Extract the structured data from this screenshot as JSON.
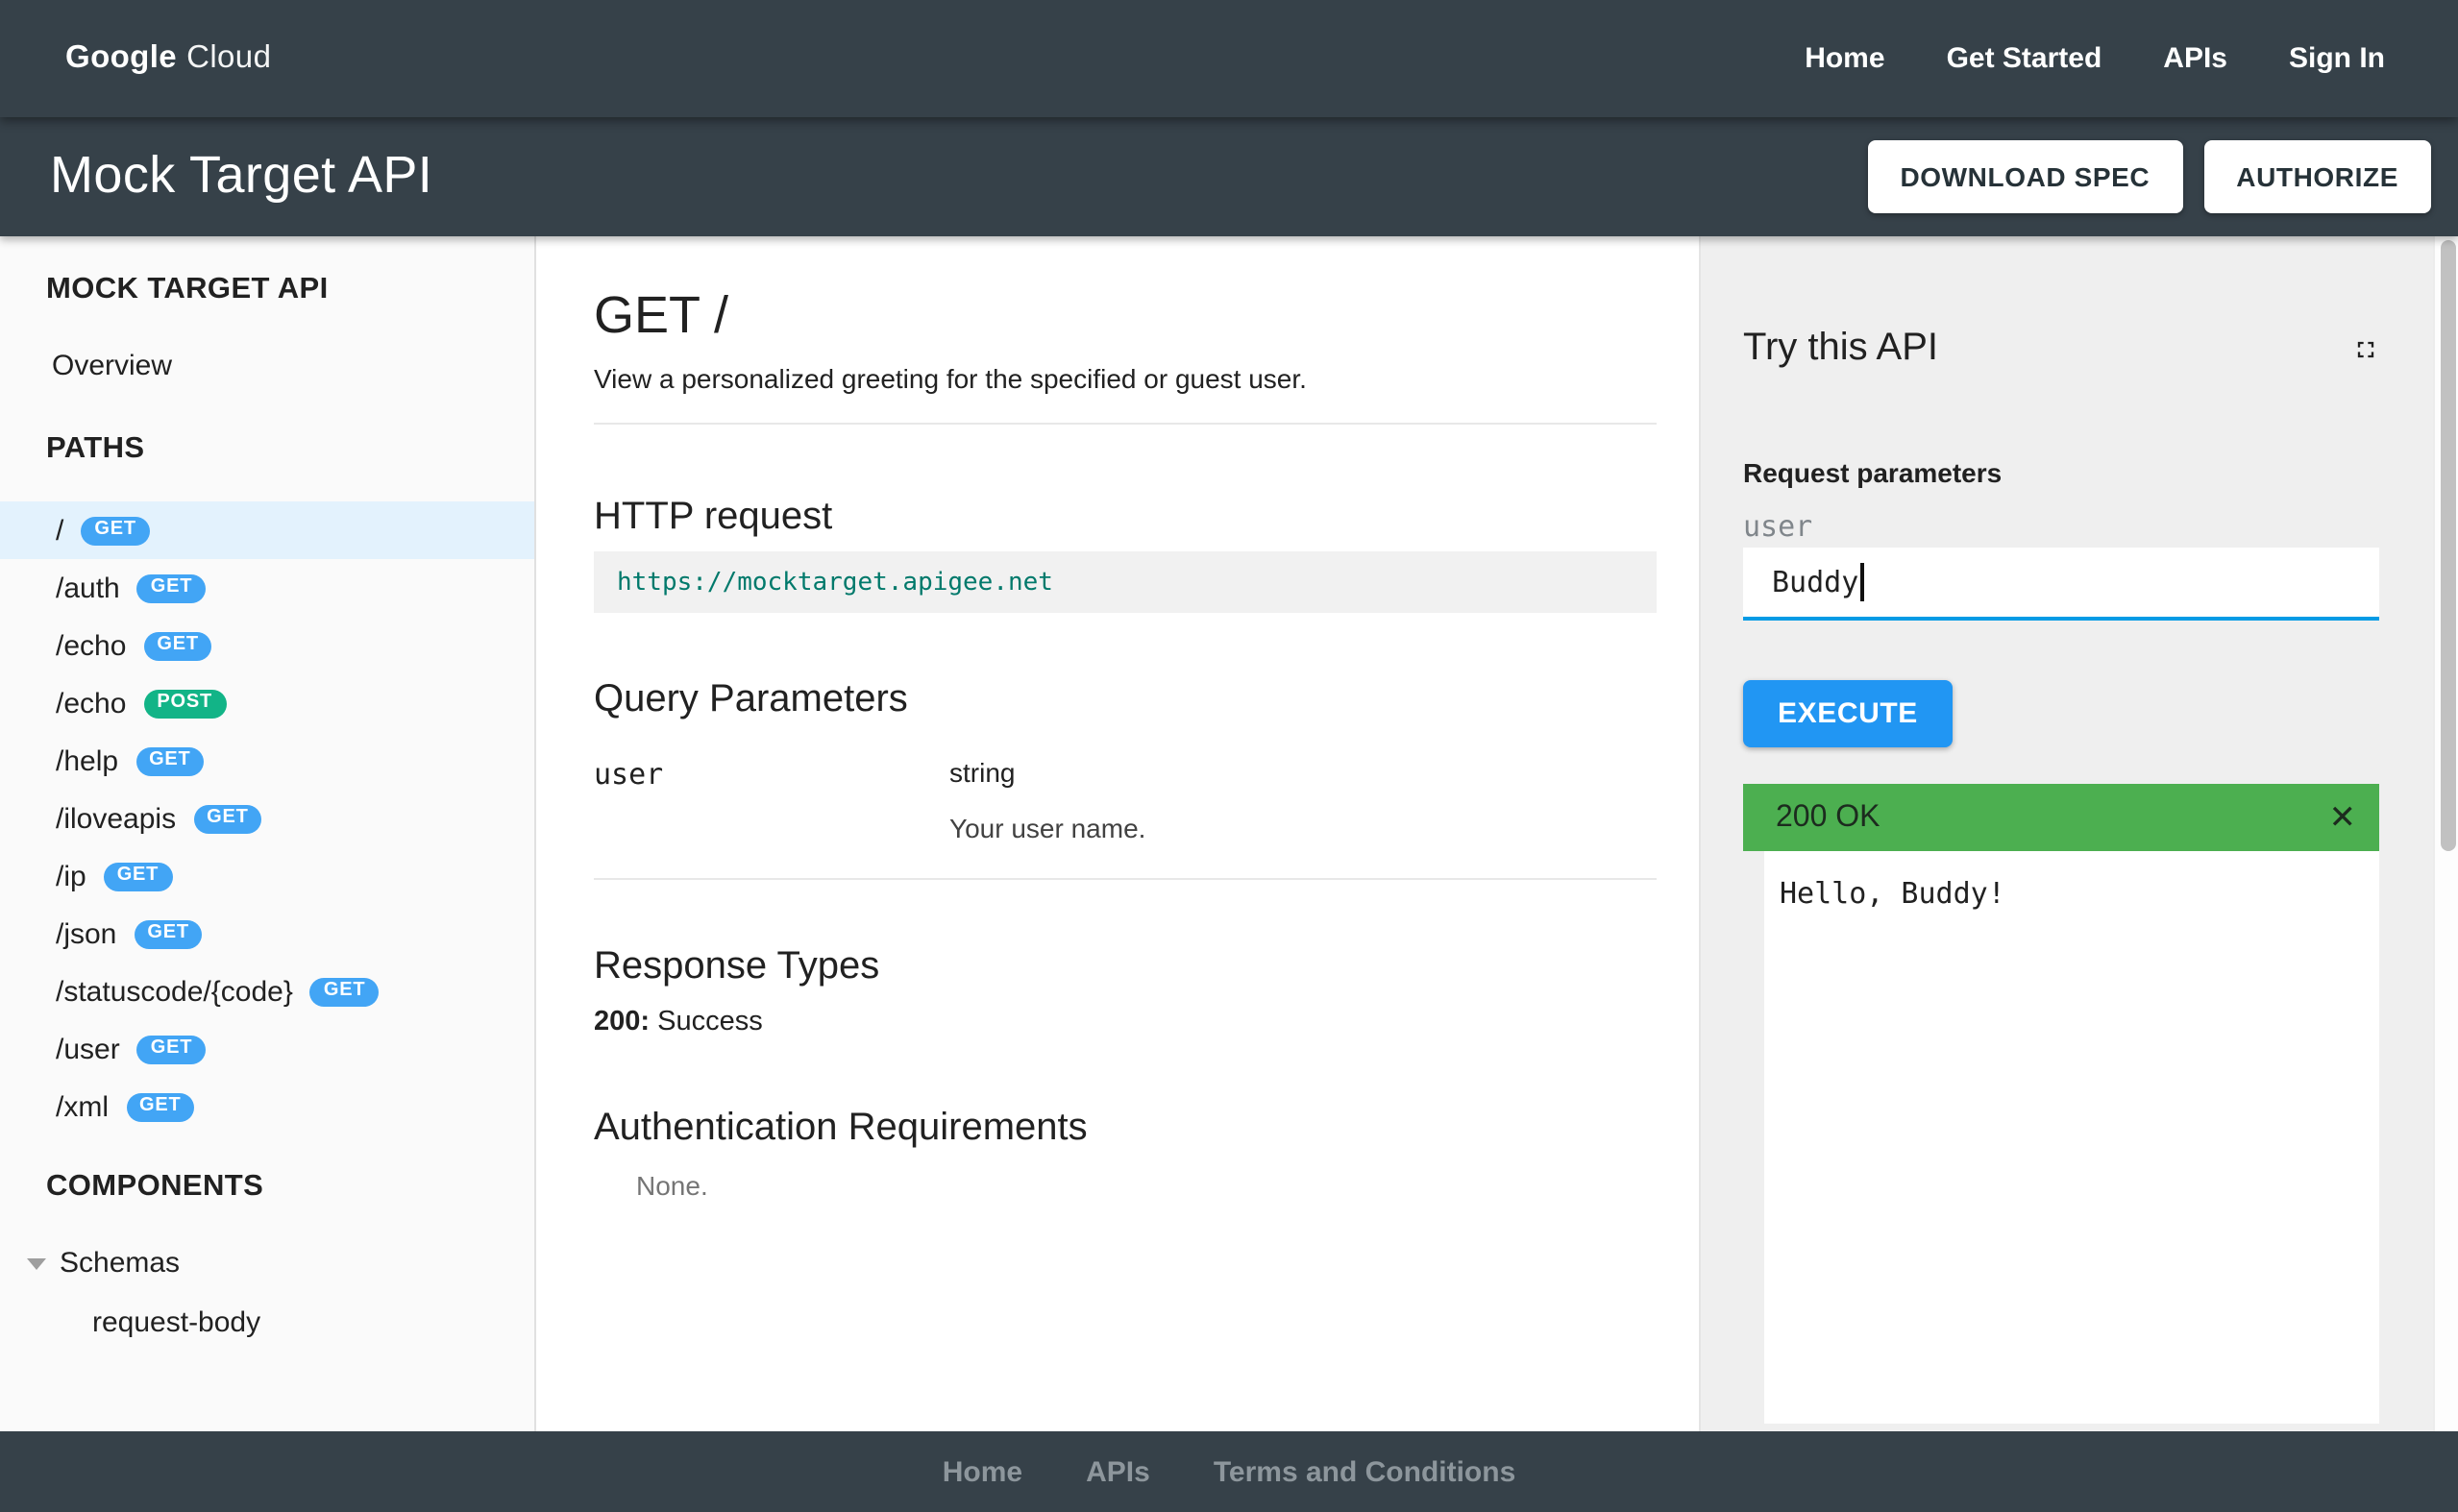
{
  "topnav": {
    "logo": {
      "google": "Google",
      "cloud": "Cloud"
    },
    "links": [
      "Home",
      "Get Started",
      "APIs",
      "Sign In"
    ]
  },
  "titlebar": {
    "title": "Mock Target API",
    "download_button": "DOWNLOAD SPEC",
    "authorize_button": "AUTHORIZE"
  },
  "sidebar": {
    "api_title": "MOCK TARGET API",
    "overview": "Overview",
    "paths_header": "PATHS",
    "paths": [
      {
        "label": "/",
        "method": "GET"
      },
      {
        "label": "/auth",
        "method": "GET"
      },
      {
        "label": "/echo",
        "method": "GET"
      },
      {
        "label": "/echo",
        "method": "POST"
      },
      {
        "label": "/help",
        "method": "GET"
      },
      {
        "label": "/iloveapis",
        "method": "GET"
      },
      {
        "label": "/ip",
        "method": "GET"
      },
      {
        "label": "/json",
        "method": "GET"
      },
      {
        "label": "/statuscode/{code}",
        "method": "GET"
      },
      {
        "label": "/user",
        "method": "GET"
      },
      {
        "label": "/xml",
        "method": "GET"
      }
    ],
    "components_header": "COMPONENTS",
    "schemas_label": "Schemas",
    "schema_items": [
      "request-body"
    ]
  },
  "main": {
    "title": "GET /",
    "description": "View a personalized greeting for the specified or guest user.",
    "http_request": {
      "heading": "HTTP request",
      "url": "https://mocktarget.apigee.net"
    },
    "query_parameters": {
      "heading": "Query Parameters",
      "rows": [
        {
          "name": "user",
          "type": "string",
          "description": "Your user name."
        }
      ]
    },
    "response_types": {
      "heading": "Response Types",
      "code": "200:",
      "text": "Success"
    },
    "auth": {
      "heading": "Authentication Requirements",
      "value": "None."
    }
  },
  "try_panel": {
    "heading": "Try this API",
    "request_parameters_label": "Request parameters",
    "param_name": "user",
    "param_value": "Buddy",
    "execute_button": "EXECUTE",
    "response_status": "200 OK",
    "response_body": "Hello, Buddy!"
  },
  "footer": {
    "links": [
      "Home",
      "APIs",
      "Terms and Conditions"
    ]
  },
  "colors": {
    "header_bg": "#364149",
    "get_badge": "#42a5f5",
    "post_badge": "#12b487",
    "execute_blue": "#2196f3",
    "input_underline": "#039be5",
    "success_green": "#4caf50",
    "active_item_bg": "#e3f2fd",
    "url_teal": "#00796b"
  }
}
